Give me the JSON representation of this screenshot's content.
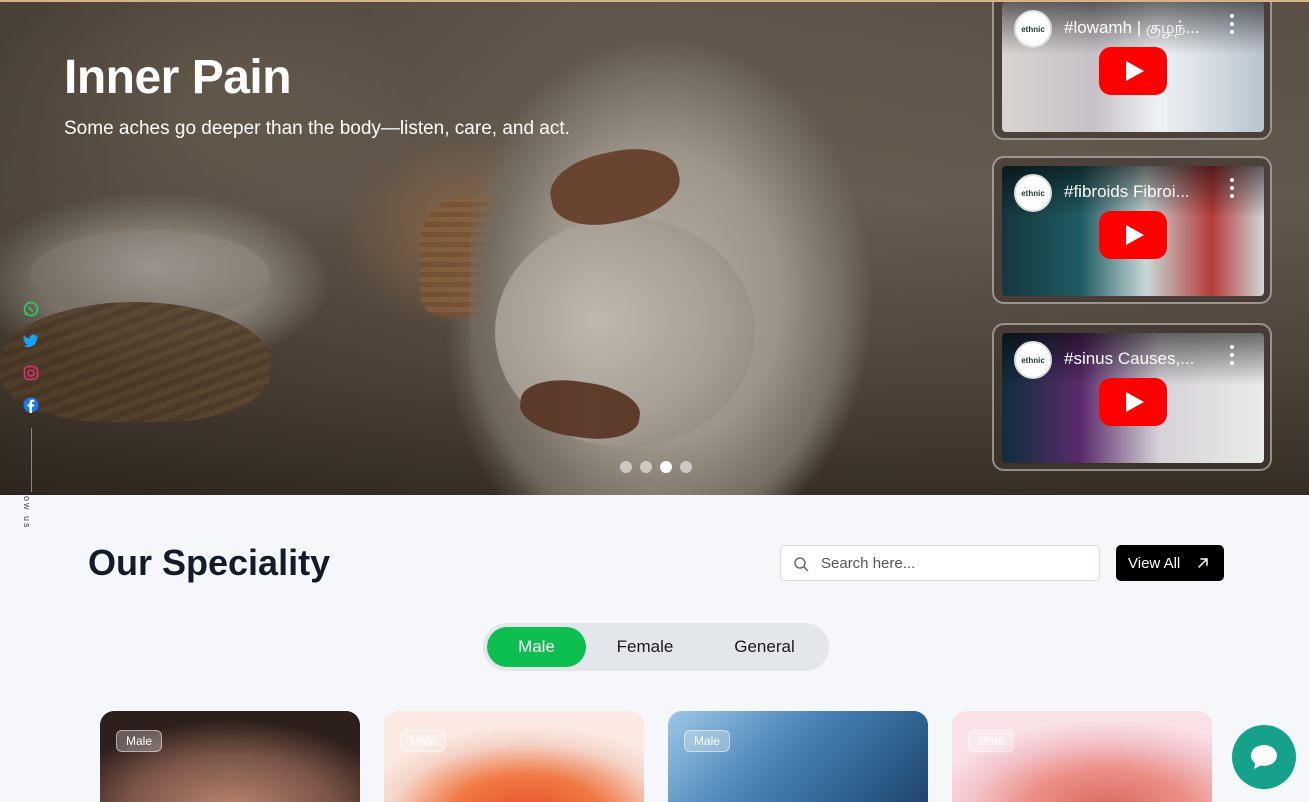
{
  "hero": {
    "title": "Inner Pain",
    "subtitle": "Some aches go deeper than the body—listen, care, and act.",
    "slide_index": 3,
    "slide_count": 4
  },
  "videos": [
    {
      "title": "#lowamh | குழந்...",
      "channel": "ethnic",
      "play_icon": "play-button-icon",
      "menu_icon": "kebab-menu-icon"
    },
    {
      "title": "#fibroids Fibroi...",
      "channel": "ethnic",
      "play_icon": "play-button-icon",
      "menu_icon": "kebab-menu-icon"
    },
    {
      "title": "#sinus Causes,...",
      "channel": "ethnic",
      "play_icon": "play-button-icon",
      "menu_icon": "kebab-menu-icon"
    }
  ],
  "social": {
    "icons": [
      "whatsapp-icon",
      "twitter-icon",
      "instagram-icon",
      "facebook-icon"
    ],
    "label": "ow us"
  },
  "speciality": {
    "title": "Our Speciality",
    "search_placeholder": "Search here...",
    "view_all_label": "View All",
    "tabs": [
      {
        "label": "Male",
        "active": true
      },
      {
        "label": "Female",
        "active": false
      },
      {
        "label": "General",
        "active": false
      }
    ],
    "cards": [
      {
        "badge": "Male"
      },
      {
        "badge": "Male"
      },
      {
        "badge": "Male"
      },
      {
        "badge": "Male"
      }
    ]
  },
  "chat": {
    "icon": "chat-bubble-icon"
  },
  "colors": {
    "accent_green": "#0cbf4e",
    "chat_teal": "#16a18a",
    "youtube_red": "#ff0000",
    "whatsapp": "#25d366",
    "twitter": "#1da1f2",
    "instagram": "#e1306c",
    "facebook": "#1877f2"
  }
}
